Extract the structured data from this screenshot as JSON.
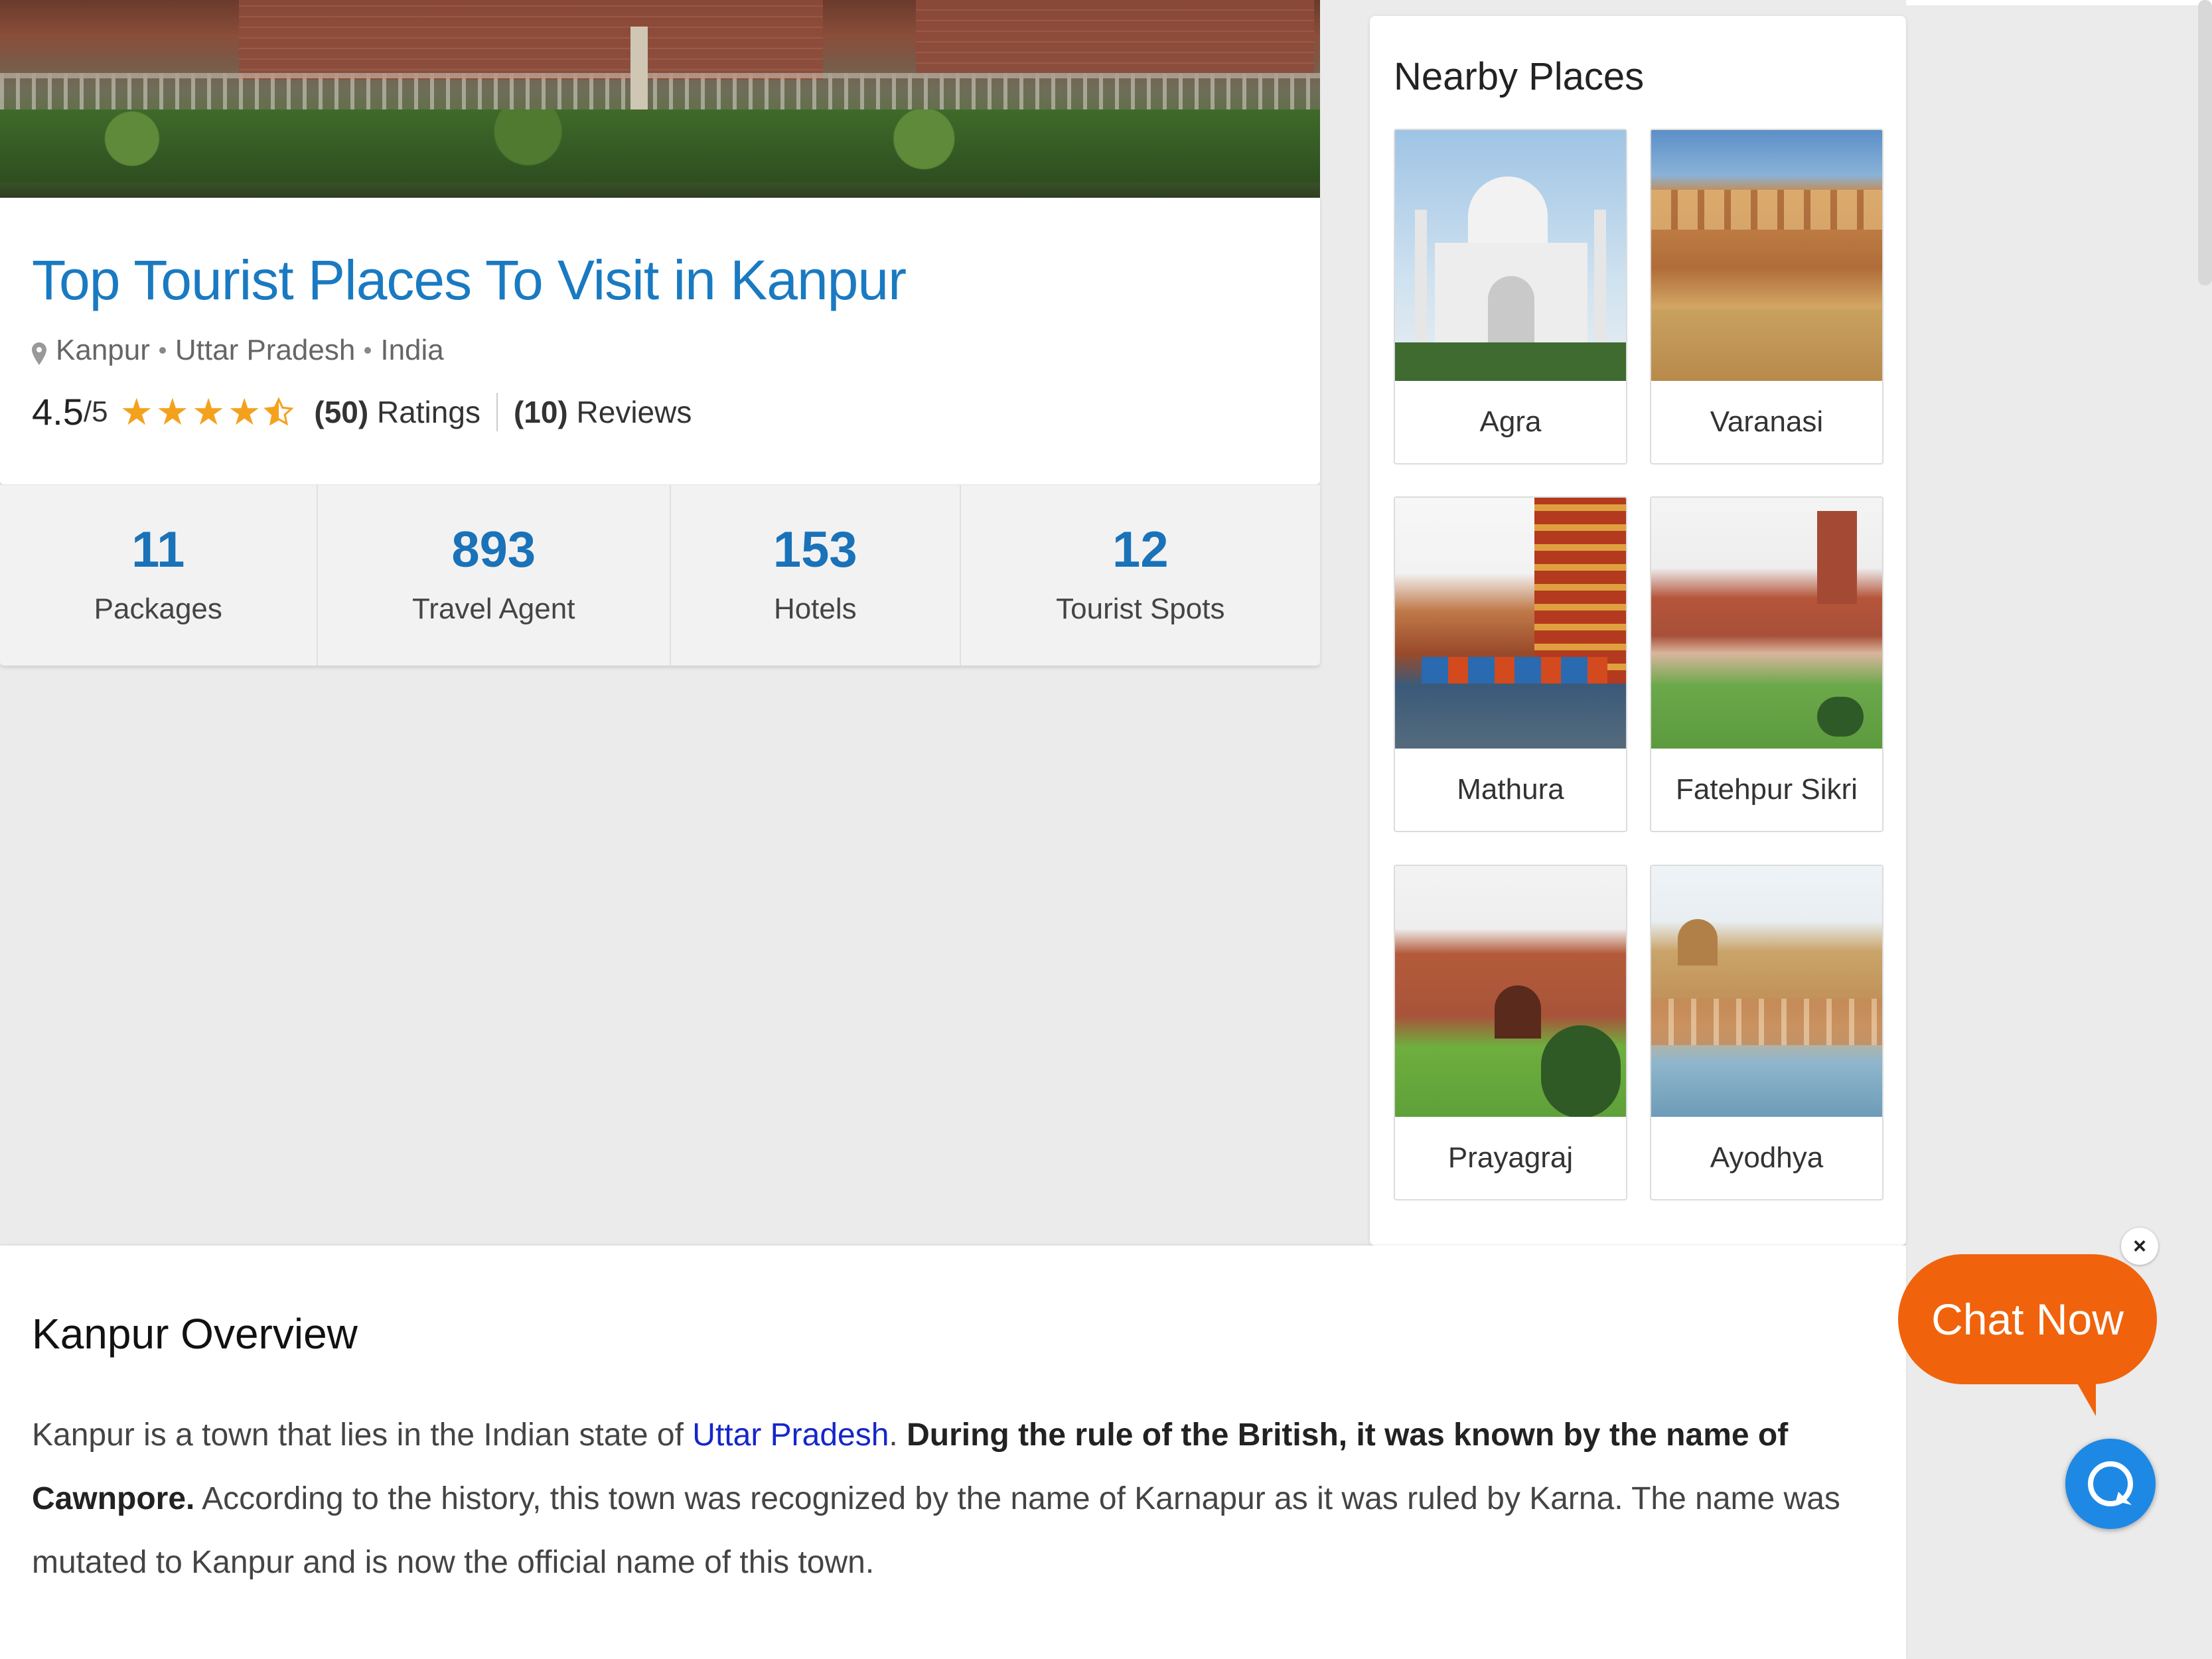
{
  "place": {
    "title": "Top Tourist Places To Visit in Kanpur",
    "location": [
      "Kanpur",
      "Uttar Pradesh",
      "India"
    ],
    "rating": {
      "score": "4.5",
      "out_of": "/5",
      "stars": 4.5,
      "ratings_count": "(50)",
      "ratings_label": "Ratings",
      "reviews_count": "(10)",
      "reviews_label": "Reviews"
    }
  },
  "stats": [
    {
      "value": "11",
      "label": "Packages"
    },
    {
      "value": "893",
      "label": "Travel Agent"
    },
    {
      "value": "153",
      "label": "Hotels"
    },
    {
      "value": "12",
      "label": "Tourist Spots"
    }
  ],
  "nearby": {
    "heading": "Nearby Places",
    "places": [
      {
        "name": "Agra"
      },
      {
        "name": "Varanasi"
      },
      {
        "name": "Mathura"
      },
      {
        "name": "Fatehpur Sikri"
      },
      {
        "name": "Prayagraj"
      },
      {
        "name": "Ayodhya"
      }
    ]
  },
  "overview": {
    "heading": "Kanpur Overview",
    "text_1": "Kanpur is a town that lies in the Indian state of ",
    "link": "Uttar Pradesh",
    "text_2": ". ",
    "bold": "During the rule of the British, it was known by the name of Cawnpore.",
    "text_3": " According to the history, this town was recognized by the name of Karnapur as it was ruled by Karna. The name was mutated to Kanpur and is now the official name of this town."
  },
  "chat": {
    "label": "Chat Now",
    "close": "×"
  },
  "colors": {
    "title_blue": "#1a7ac1",
    "stat_blue": "#1a72b8",
    "star": "#f4a11e",
    "chat_orange": "#f0630c",
    "chat_fab": "#1e88e5",
    "link": "#1626c9"
  },
  "icons": [
    "location-pin-icon",
    "star-icon",
    "half-star-icon",
    "close-icon",
    "chat-icon"
  ]
}
